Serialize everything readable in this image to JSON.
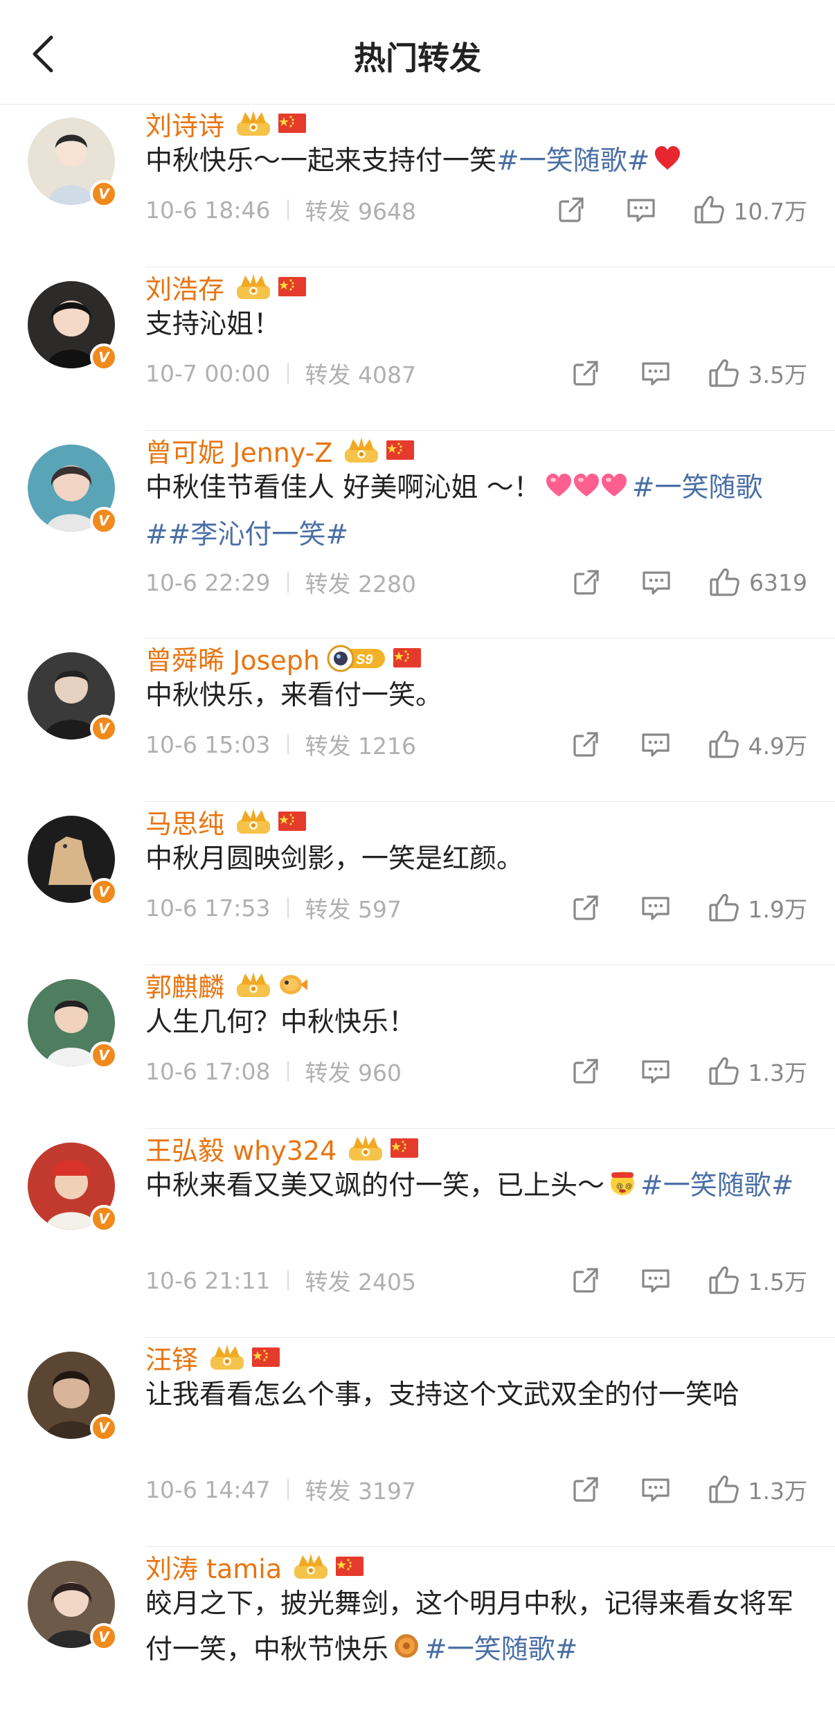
{
  "header": {
    "title": "热门转发"
  },
  "items": [
    {
      "name": "刘诗诗",
      "badges": [
        "crown",
        "flag"
      ],
      "pre": "中秋快乐～一起来支持付一笑",
      "topic": "#一笑随歌#",
      "post": "",
      "emoji": "heart",
      "time": "10-6 18:46",
      "repost": "转发 9648",
      "likes": "10.7万",
      "avatarColor": "#e9e2d6"
    },
    {
      "name": "刘浩存",
      "badges": [
        "crown",
        "flag"
      ],
      "pre": "支持沁姐！",
      "topic": "",
      "post": "",
      "emoji": "",
      "time": "10-7 00:00",
      "repost": "转发 4087",
      "likes": "3.5万",
      "avatarColor": "#2d2a2a"
    },
    {
      "name": "曾可妮 Jenny-Z",
      "badges": [
        "crown",
        "flag"
      ],
      "pre": "中秋佳节看佳人 好美啊沁姐 ～！",
      "topic": "#一笑随歌##李沁付一笑#",
      "post": "",
      "emoji": "hearts3",
      "time": "10-6 22:29",
      "repost": "转发 2280",
      "likes": "6319",
      "avatarColor": "#5aa4b8"
    },
    {
      "name": "曾舜晞 Joseph",
      "badges": [
        "astronaut",
        "flag"
      ],
      "pre": "中秋快乐，来看付一笑。",
      "topic": "",
      "post": "",
      "emoji": "",
      "time": "10-6 15:03",
      "repost": "转发 1216",
      "likes": "4.9万",
      "avatarColor": "#3a3a3a"
    },
    {
      "name": "马思纯",
      "badges": [
        "crown",
        "flag"
      ],
      "pre": "中秋月圆映剑影，一笑是红颜。",
      "topic": "",
      "post": "",
      "emoji": "",
      "time": "10-6 17:53",
      "repost": "转发 597",
      "likes": "1.9万",
      "avatarColor": "#1c1c1c"
    },
    {
      "name": "郭麒麟",
      "badges": [
        "crown",
        "fish"
      ],
      "pre": "人生几何？中秋快乐！",
      "topic": "",
      "post": "",
      "emoji": "",
      "time": "10-6 17:08",
      "repost": "转发 960",
      "likes": "1.3万",
      "avatarColor": "#4e7d5f"
    },
    {
      "name": "王弘毅 why324",
      "badges": [
        "crown",
        "flag"
      ],
      "pre": "中秋来看又美又飒的付一笑，已上头～",
      "topic": "#一笑随歌#",
      "post": "",
      "emoji": "dizzy",
      "time": "10-6 21:11",
      "repost": "转发 2405",
      "likes": "1.5万",
      "avatarColor": "#c23a2e"
    },
    {
      "name": "汪铎",
      "badges": [
        "crown",
        "flag"
      ],
      "pre": "让我看看怎么个事，支持这个文武双全的付一笑哈",
      "topic": "",
      "post": "",
      "emoji": "",
      "time": "10-6 14:47",
      "repost": "转发 3197",
      "likes": "1.3万",
      "avatarColor": "#5b4634"
    },
    {
      "name": "刘涛 tamia",
      "badges": [
        "crown",
        "flag"
      ],
      "pre": "皎月之下，披光舞剑，这个明月中秋，记得来看女将军付一笑，中秋节快乐",
      "topic": "#一笑随歌#",
      "post": "",
      "emoji": "mooncake",
      "time": "",
      "repost": "",
      "likes": "",
      "avatarColor": "#6d5a48"
    }
  ]
}
